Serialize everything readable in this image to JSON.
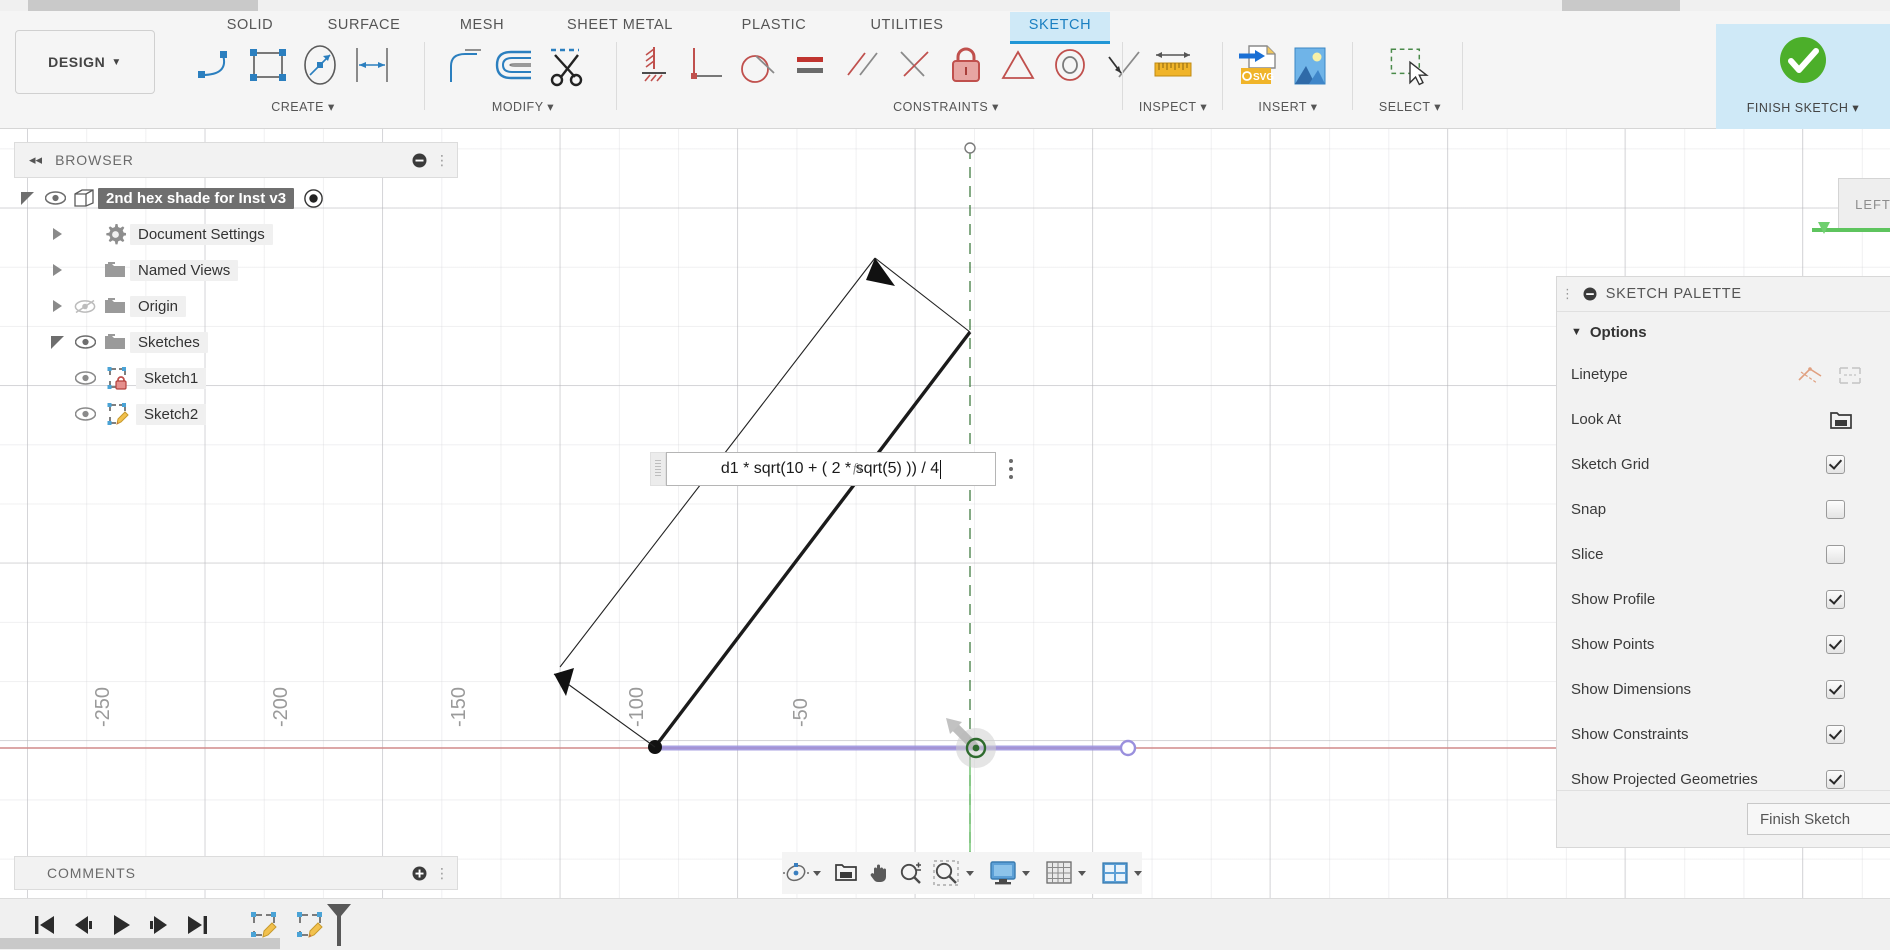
{
  "app": {
    "workspace": "DESIGN",
    "viewcube_face": "LEFT"
  },
  "ribbon": {
    "tabs": [
      {
        "label": "SOLID",
        "active": false
      },
      {
        "label": "SURFACE",
        "active": false
      },
      {
        "label": "MESH",
        "active": false
      },
      {
        "label": "SHEET METAL",
        "active": false
      },
      {
        "label": "PLASTIC",
        "active": false
      },
      {
        "label": "UTILITIES",
        "active": false
      },
      {
        "label": "SKETCH",
        "active": true
      }
    ],
    "groups": [
      {
        "label": "CREATE ▾",
        "tools": [
          "line-icon",
          "rectangle-icon",
          "circle-icon",
          "sketch-dimension-icon"
        ]
      },
      {
        "label": "MODIFY ▾",
        "tools": [
          "fillet-icon",
          "offset-icon",
          "trim-scissors-icon"
        ]
      },
      {
        "label": "CONSTRAINTS ▾",
        "tools": [
          "horizontal-vertical-icon",
          "perpendicular-icon",
          "tangent-icon",
          "equal-icon",
          "parallel-icon",
          "midpoint-icon",
          "fix-lock-icon",
          "symmetry-icon",
          "concentric-icon",
          "curvature-icon"
        ]
      },
      {
        "label": "INSPECT ▾",
        "tools": [
          "measure-ruler-icon"
        ]
      },
      {
        "label": "INSERT ▾",
        "tools": [
          "insert-svg-icon",
          "insert-image-icon"
        ]
      },
      {
        "label": "SELECT ▾",
        "tools": [
          "select-window-icon"
        ]
      },
      {
        "label": "FINISH SKETCH ▾",
        "tools": [
          "finish-sketch-check-icon"
        ]
      }
    ]
  },
  "browser": {
    "title": "BROWSER",
    "collapse_icon": "collapse-left-icon",
    "minus_icon": "minus-circle-icon",
    "items": [
      {
        "label": "2nd hex shade for Inst v3",
        "depth": 0,
        "expander": "down",
        "eye": true,
        "icon": "component-cube-icon",
        "selected": true,
        "radio": true
      },
      {
        "label": "Document Settings",
        "depth": 1,
        "expander": "right",
        "eye": false,
        "icon": "gear-icon",
        "selected": false,
        "radio": false
      },
      {
        "label": "Named Views",
        "depth": 1,
        "expander": "right",
        "eye": false,
        "icon": "folder-icon",
        "selected": false,
        "radio": false
      },
      {
        "label": "Origin",
        "depth": 1,
        "expander": "right",
        "eye": "hidden",
        "icon": "folder-icon",
        "selected": false,
        "radio": false
      },
      {
        "label": "Sketches",
        "depth": 1,
        "expander": "down",
        "eye": true,
        "icon": "folder-icon",
        "selected": false,
        "radio": false
      },
      {
        "label": "Sketch1",
        "depth": 2,
        "expander": "none",
        "eye": true,
        "icon": "sketch-locked-icon",
        "selected": false,
        "radio": false
      },
      {
        "label": "Sketch2",
        "depth": 2,
        "expander": "none",
        "eye": true,
        "icon": "sketch-editing-icon",
        "selected": false,
        "radio": false
      }
    ]
  },
  "comments": {
    "title": "COMMENTS",
    "add_icon": "plus-circle-icon"
  },
  "palette": {
    "title": "SKETCH PALETTE",
    "collapse_icon": "minus-circle-icon",
    "section": "Options",
    "rows": [
      {
        "label": "Linetype",
        "control": "linetype-icons"
      },
      {
        "label": "Look At",
        "control": "look-at-icon"
      },
      {
        "label": "Sketch Grid",
        "control": "checkbox",
        "checked": true
      },
      {
        "label": "Snap",
        "control": "checkbox",
        "checked": false
      },
      {
        "label": "Slice",
        "control": "checkbox",
        "checked": false
      },
      {
        "label": "Show Profile",
        "control": "checkbox",
        "checked": true
      },
      {
        "label": "Show Points",
        "control": "checkbox",
        "checked": true
      },
      {
        "label": "Show Dimensions",
        "control": "checkbox",
        "checked": true
      },
      {
        "label": "Show Constraints",
        "control": "checkbox",
        "checked": true
      },
      {
        "label": "Show Projected Geometries",
        "control": "checkbox",
        "checked": true
      }
    ],
    "finish_button": "Finish Sketch"
  },
  "canvas": {
    "dimension_editor": {
      "value": "d1 * sqrt(10 + ( 2 * sqrt(5) )) / 4",
      "fx_badge": "fx",
      "overflow_icon": "more-options-icon",
      "grip_icon": "drag-grip-icon"
    },
    "axis_labels": [
      "-250",
      "-200",
      "-150",
      "-100",
      "-50"
    ],
    "origin_marker": "origin-point-icon"
  },
  "navbar": {
    "buttons": [
      {
        "icon": "orbit-icon",
        "caret": true
      },
      {
        "icon": "look-at-icon",
        "caret": false
      },
      {
        "icon": "pan-hand-icon",
        "caret": false
      },
      {
        "icon": "zoom-magnifier-icon",
        "caret": false
      },
      {
        "icon": "zoom-window-icon",
        "caret": true
      },
      {
        "icon": "display-settings-icon",
        "caret": true
      },
      {
        "icon": "grid-snaps-icon",
        "caret": true
      },
      {
        "icon": "viewports-icon",
        "caret": true
      }
    ]
  },
  "timeline": {
    "buttons": [
      {
        "icon": "jump-to-beginning-icon"
      },
      {
        "icon": "step-back-icon"
      },
      {
        "icon": "play-icon"
      },
      {
        "icon": "step-forward-icon"
      },
      {
        "icon": "jump-to-end-icon"
      }
    ],
    "features": [
      {
        "icon": "sketch-feature-icon"
      },
      {
        "icon": "sketch-feature-active-icon"
      }
    ],
    "marker_icon": "timeline-marker-icon"
  },
  "colors": {
    "accent": "#2196d6",
    "accent_bg": "#cfe9f7",
    "sketch_line": "#1b1b1b",
    "projected_line": "#8f86d6",
    "x_axis": "#c87070",
    "y_axis": "#4a7a4a",
    "green_check": "#4caf2a",
    "constraint_red": "#c0504d"
  }
}
